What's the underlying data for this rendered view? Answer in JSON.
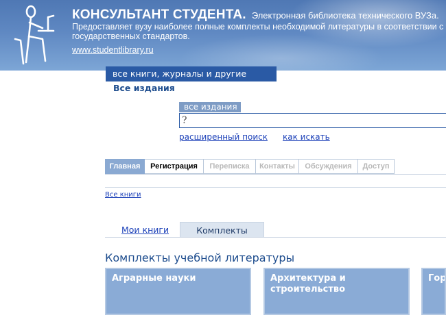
{
  "header": {
    "brand_name": "КОНСУЛЬТАНТ СТУДЕНТА.",
    "brand_subtitle": "Электронная библиотека технического ВУЗа.",
    "description_line1": "Предоставляет вузу наиболее полные комплекты необходимой литературы в соответствии с уч",
    "description_line2": "государственных стандартов.",
    "site_link": "www.studentlibrary.ru"
  },
  "collection_tab": "все книги, журналы и другие издания",
  "section_title": "Все издания",
  "search": {
    "label": "все издания",
    "value": "?",
    "advanced_link": "расширенный поиск",
    "how_link": "как искать"
  },
  "nav_tabs": [
    {
      "label": "Главная",
      "state": "active"
    },
    {
      "label": "Регистрация",
      "state": "normal"
    },
    {
      "label": "Переписка",
      "state": "disabled"
    },
    {
      "label": "Контакты",
      "state": "disabled"
    },
    {
      "label": "Обсуждения",
      "state": "disabled"
    },
    {
      "label": "Доступ",
      "state": "disabled"
    }
  ],
  "breadcrumb": "Все книги",
  "sub_tabs": {
    "my_books": "Мои книги",
    "sets": "Комплекты"
  },
  "kits_title": "Комплекты учебной литературы",
  "categories": [
    {
      "label_line1": "Аграрные науки",
      "label_line2": ""
    },
    {
      "label_line1": "Архитектура и",
      "label_line2": "строительство"
    },
    {
      "label_line1": "Гор",
      "label_line2": ""
    }
  ],
  "colors": {
    "header_blue": "#5f88c2",
    "accent_blue": "#2a5aa5",
    "title_blue": "#1e4d8e",
    "link_blue": "#1a3fb8",
    "card_blue": "#8aabd6"
  }
}
